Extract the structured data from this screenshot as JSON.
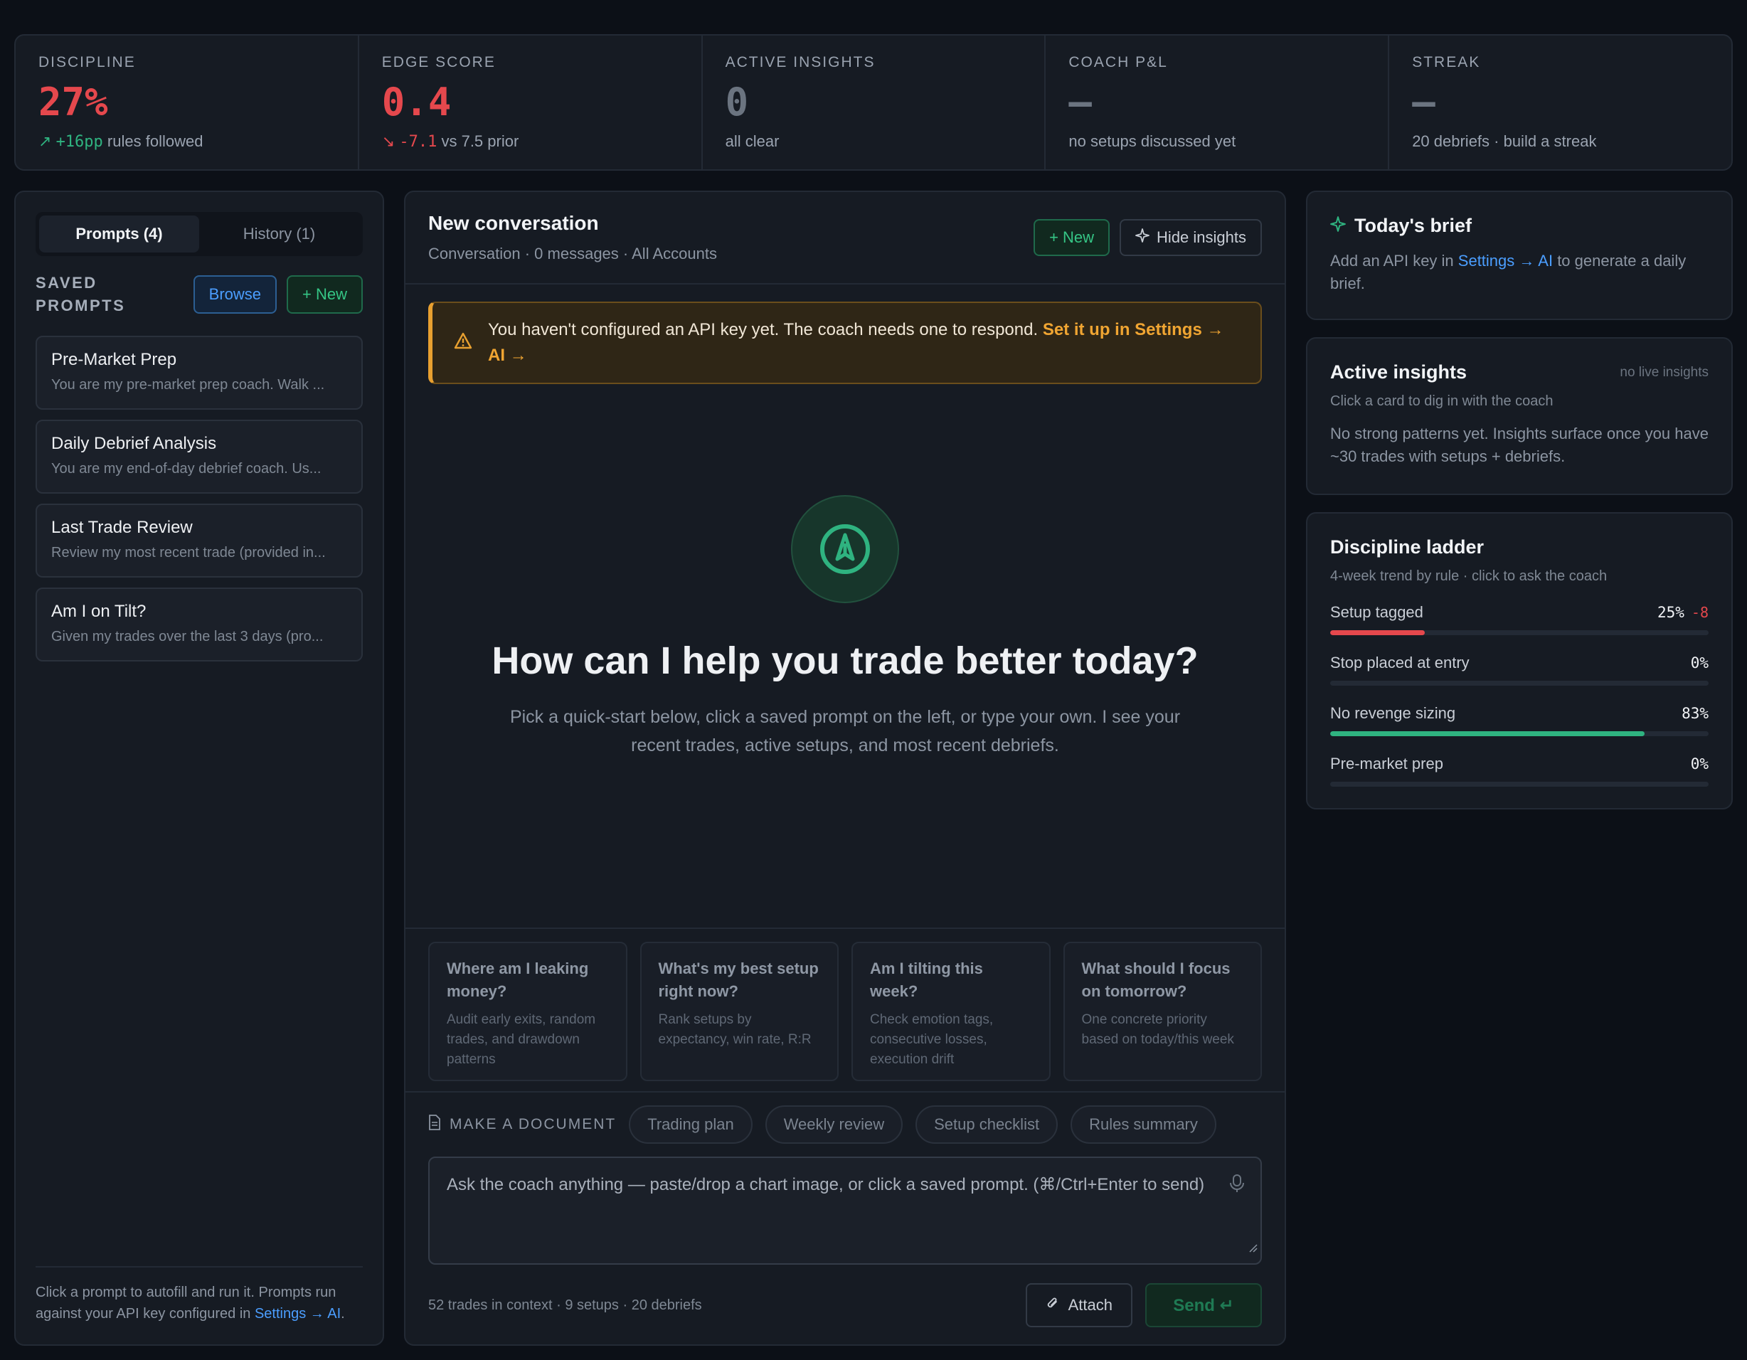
{
  "kpis": [
    {
      "label": "DISCIPLINE",
      "value": "27%",
      "delta": "+16pp",
      "sub": "rules followed",
      "tone": "red",
      "delta_tone": "green",
      "delta_arrow": "↗"
    },
    {
      "label": "EDGE SCORE",
      "value": "0.4",
      "delta": "-7.1",
      "sub": "vs 7.5 prior",
      "tone": "red",
      "delta_tone": "red",
      "delta_arrow": "↘"
    },
    {
      "label": "ACTIVE INSIGHTS",
      "value": "0",
      "sub": "all clear",
      "tone": "muted"
    },
    {
      "label": "COACH P&L",
      "value": "—",
      "sub": "no setups discussed yet",
      "tone": "muted"
    },
    {
      "label": "STREAK",
      "value": "—",
      "sub": "20 debriefs · build a streak",
      "tone": "muted"
    }
  ],
  "left": {
    "tabs": [
      "Prompts (4)",
      "History (1)"
    ],
    "saved_title": "SAVED PROMPTS",
    "browse_label": "Browse",
    "new_label": "+ New",
    "prompts": [
      {
        "title": "Pre-Market Prep",
        "preview": "You are my pre-market prep coach. Walk ..."
      },
      {
        "title": "Daily Debrief Analysis",
        "preview": "You are my end-of-day debrief coach. Us..."
      },
      {
        "title": "Last Trade Review",
        "preview": "Review my most recent trade (provided in..."
      },
      {
        "title": "Am I on Tilt?",
        "preview": "Given my trades over the last 3 days (pro..."
      }
    ],
    "footer_text": "Click a prompt to autofill and run it. Prompts run against your API key configured in ",
    "footer_link": "Settings → AI",
    "footer_end": "."
  },
  "center": {
    "title": "New conversation",
    "subtitle": "Conversation · 0 messages · All Accounts",
    "new_label": "+ New",
    "hide_label": "Hide insights",
    "alert_text": "You haven't configured an API key yet. The coach needs one to respond. ",
    "alert_link": "Set it up in Settings → AI →",
    "hero_title": "How can I help you trade better today?",
    "hero_sub": "Pick a quick-start below, click a saved prompt on the left, or type your own. I see your recent trades, active setups, and most recent debriefs.",
    "quick_starts": [
      {
        "title": "Where am I leaking money?",
        "sub": "Audit early exits, random trades, and drawdown patterns"
      },
      {
        "title": "What's my best setup right now?",
        "sub": "Rank setups by expectancy, win rate, R:R"
      },
      {
        "title": "Am I tilting this week?",
        "sub": "Check emotion tags, consecutive losses, execution drift"
      },
      {
        "title": "What should I focus on tomorrow?",
        "sub": "One concrete priority based on today/this week"
      }
    ],
    "doc_label": "MAKE A DOCUMENT",
    "doc_chips": [
      "Trading plan",
      "Weekly review",
      "Setup checklist",
      "Rules summary"
    ],
    "input_placeholder": "Ask the coach anything — paste/drop a chart image, or click a saved prompt. (⌘/Ctrl+Enter to send)",
    "context": "52 trades in context · 9 setups · 20 debriefs",
    "attach_label": "Attach",
    "send_label": "Send ↵"
  },
  "right": {
    "brief_title": "Today's brief",
    "brief_text": "Add an API key in ",
    "brief_link": "Settings → AI",
    "brief_end": " to generate a daily brief.",
    "insights_title": "Active insights",
    "insights_tag": "no live insights",
    "insights_meta": "Click a card to dig in with the coach",
    "insights_text": "No strong patterns yet. Insights surface once you have ~30 trades with setups + debriefs.",
    "ladder_title": "Discipline ladder",
    "ladder_meta": "4-week trend by rule · click to ask the coach",
    "ladder": [
      {
        "label": "Setup tagged",
        "value": "25%",
        "delta": "-8",
        "fill": 0.25,
        "color": "#e5484d"
      },
      {
        "label": "Stop placed at entry",
        "value": "0%",
        "delta": "",
        "fill": 0,
        "color": "#e5484d"
      },
      {
        "label": "No revenge sizing",
        "value": "83%",
        "delta": "",
        "fill": 0.83,
        "color": "#2fb380"
      },
      {
        "label": "Pre-market prep",
        "value": "0%",
        "delta": "",
        "fill": 0,
        "color": "#e5484d"
      }
    ]
  },
  "colors": {
    "accent_green": "#2fb380",
    "danger_red": "#e5484d",
    "warning_orange": "#e8a030",
    "link_blue": "#4b9eff"
  }
}
